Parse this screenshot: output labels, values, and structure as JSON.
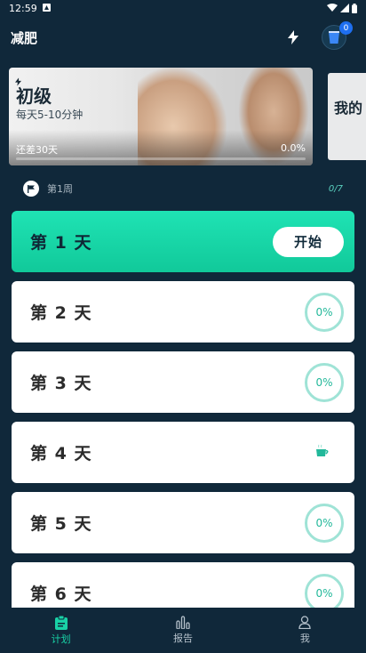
{
  "status_bar": {
    "time": "12:59"
  },
  "header": {
    "title": "减肥",
    "badge_count": "0"
  },
  "banner": {
    "level": "初级",
    "subtitle": "每天5-10分钟",
    "remaining": "还差30天",
    "progress_text": "0.0%",
    "progress_value": 0.0
  },
  "banner2": {
    "label": "我的"
  },
  "week": {
    "label": "第1周",
    "count": "0/7"
  },
  "days": [
    {
      "label": "第 1 天",
      "type": "start",
      "button": "开始"
    },
    {
      "label": "第 2 天",
      "type": "progress",
      "value": "0%"
    },
    {
      "label": "第 3 天",
      "type": "progress",
      "value": "0%"
    },
    {
      "label": "第 4 天",
      "type": "rest"
    },
    {
      "label": "第 5 天",
      "type": "progress",
      "value": "0%"
    },
    {
      "label": "第 6 天",
      "type": "progress",
      "value": "0%"
    }
  ],
  "nav": {
    "plan": "计划",
    "report": "报告",
    "me": "我"
  },
  "colors": {
    "background": "#10283a",
    "accent": "#19d1a6",
    "ring": "#9fe3d6"
  }
}
